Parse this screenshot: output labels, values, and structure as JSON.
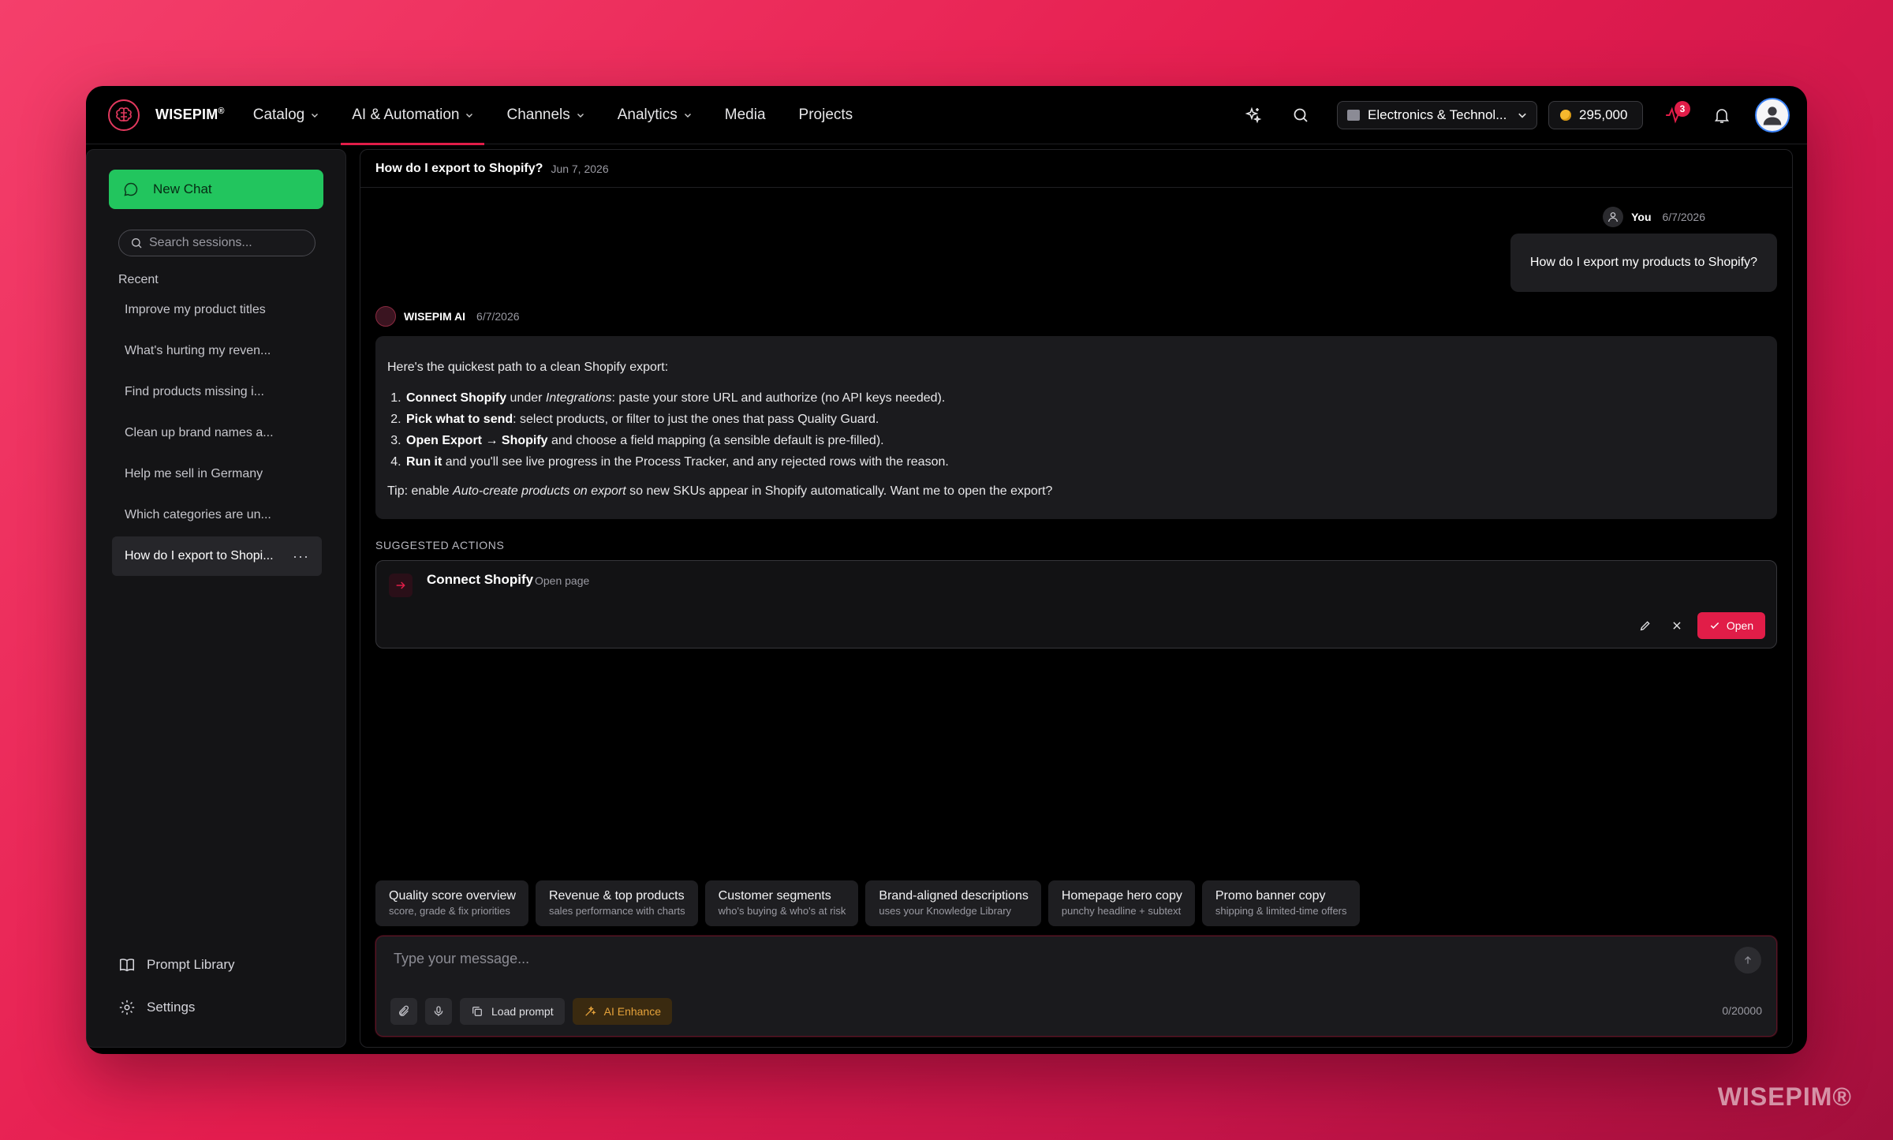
{
  "brand": {
    "name": "WISEPIM",
    "reg": "®",
    "watermark": "WISEPIM®",
    "accent": "#e11d48",
    "green": "#22c55e"
  },
  "nav": [
    {
      "label": "Catalog",
      "has_menu": true
    },
    {
      "label": "AI & Automation",
      "has_menu": true,
      "active": true
    },
    {
      "label": "Channels",
      "has_menu": true
    },
    {
      "label": "Analytics",
      "has_menu": true
    },
    {
      "label": "Media",
      "has_menu": false
    },
    {
      "label": "Projects",
      "has_menu": false
    }
  ],
  "topbar": {
    "store": "Electronics & Technol...",
    "credits": "295,000",
    "activity_badge": "3",
    "icons": [
      "sparkles-icon",
      "search-icon",
      "activity-icon",
      "bell-icon",
      "user-avatar"
    ]
  },
  "sidebar": {
    "new_chat": "New Chat",
    "search_placeholder": "Search sessions...",
    "recent_label": "Recent",
    "sessions": [
      "Improve my product titles",
      "What's hurting my reven...",
      "Find products missing i...",
      "Clean up brand names a...",
      "Help me sell in Germany",
      "Which categories are un...",
      "How do I export to Shopi..."
    ],
    "more": "···",
    "prompt_library": "Prompt Library",
    "settings": "Settings"
  },
  "conversation": {
    "title": "How do I export to Shopify?",
    "date": "Jun 7, 2026",
    "user": {
      "name": "You",
      "date": "6/7/2026",
      "message": "How do I export my products to Shopify?"
    },
    "ai": {
      "name": "WISEPIM AI",
      "date": "6/7/2026",
      "intro": "Here's the quickest path to a clean Shopify export:",
      "steps": [
        {
          "bold": "Connect Shopify",
          "mid": " under ",
          "em": "Integrations",
          "rest": ": paste your store URL and authorize (no API keys needed)."
        },
        {
          "bold": "Pick what to send",
          "mid": "",
          "em": "",
          "rest": ": select products, or filter to just the ones that pass Quality Guard."
        },
        {
          "bold": "Open Export → Shopify",
          "mid": "",
          "em": "",
          "rest": " and choose a field mapping (a sensible default is pre-filled)."
        },
        {
          "bold": "Run it",
          "mid": "",
          "em": "",
          "rest": " and you'll see live progress in the Process Tracker, and any rejected rows with the reason."
        }
      ],
      "tip_pre": "Tip: enable ",
      "tip_em": "Auto-create products on export",
      "tip_post": " so new SKUs appear in Shopify automatically. Want me to open the export?"
    }
  },
  "suggested": {
    "label": "SUGGESTED ACTIONS",
    "title": "Connect Shopify",
    "sub": "Open page",
    "open": "Open"
  },
  "quick_prompts": [
    {
      "title": "Quality score overview",
      "sub": "score, grade & fix priorities"
    },
    {
      "title": "Revenue & top products",
      "sub": "sales performance with charts"
    },
    {
      "title": "Customer segments",
      "sub": "who's buying & who's at risk"
    },
    {
      "title": "Brand-aligned descriptions",
      "sub": "uses your Knowledge Library"
    },
    {
      "title": "Homepage hero copy",
      "sub": "punchy headline + subtext"
    },
    {
      "title": "Promo banner copy",
      "sub": "shipping & limited-time offers"
    }
  ],
  "composer": {
    "placeholder": "Type your message...",
    "load_prompt": "Load prompt",
    "ai_enhance": "AI Enhance",
    "counter": "0/20000"
  }
}
